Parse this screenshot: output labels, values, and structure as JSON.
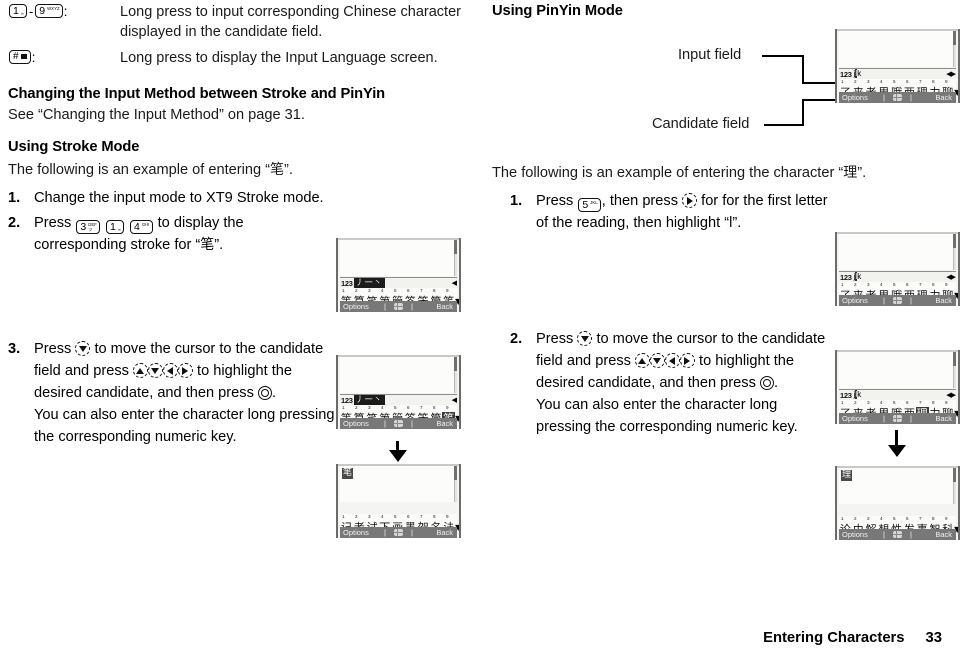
{
  "left_column": {
    "key_rows": [
      {
        "key_from": {
          "number": "1",
          "sub1": "",
          "sub2": "∞"
        },
        "key_to": {
          "number": "9",
          "sub1": "WXYZ",
          "sub2": ""
        },
        "separator": "-",
        "colon": ":",
        "text": "Long press to input corresponding Chinese character displayed in the candidate field."
      },
      {
        "key_hash": {
          "number": "#",
          "glyph": "block"
        },
        "colon": ":",
        "text": "Long press to display the Input Language screen."
      }
    ],
    "heading_1": "Changing the Input Method between Stroke and PinYin",
    "see_line": "See “Changing the Input Method” on page 31.",
    "heading_2": "Using Stroke Mode",
    "intro": {
      "before": "The following is an example of entering “",
      "char": "笔",
      "after": "”."
    },
    "steps": [
      {
        "num": "1.",
        "text": "Change the input mode to XT9 Stroke mode."
      },
      {
        "num": "2.",
        "text_before": "Press",
        "keys": [
          {
            "number": "3",
            "sub1": "DEF",
            "sub2": "ツ"
          },
          {
            "number": "1",
            "sub1": "",
            "sub2": "∞"
          },
          {
            "number": "4",
            "sub1": "GHI",
            "sub2": ""
          }
        ],
        "text_mid": "to display the corresponding stroke for “",
        "char": "笔",
        "text_after": "”."
      },
      {
        "num": "3.",
        "text_a": "Press",
        "icon_a": "nav-down-icon",
        "text_b": "to move the cursor to the candidate field and press",
        "icons_b": [
          "nav-up-icon",
          "nav-down-icon",
          "nav-left-icon",
          "nav-right-icon"
        ],
        "text_c": "to highlight the desired candidate, and then press",
        "icon_c": "center-select-icon",
        "text_d": ".",
        "text_e": "You can also enter the character long pressing the corresponding numeric key."
      }
    ]
  },
  "right_column": {
    "heading": "Using PinYin Mode",
    "callouts": {
      "input_field": "Input field",
      "candidate_field": "Candidate field"
    },
    "intro": {
      "before": "The following is an example of entering the character “",
      "char": "理",
      "after": "”."
    },
    "steps": [
      {
        "num": "1.",
        "text_a": "Press",
        "key": {
          "number": "5",
          "sub1": "JKL",
          "sub2": ""
        },
        "text_b": ", then press",
        "icon": "nav-right-icon",
        "text_c": "for for the first letter of the reading, then highlight “l”."
      },
      {
        "num": "2.",
        "text_a": "Press",
        "icon_a": "nav-down-icon",
        "text_b": "to move the cursor to the candidate field and press",
        "icons_b": [
          "nav-up-icon",
          "nav-down-icon",
          "nav-left-icon",
          "nav-right-icon"
        ],
        "text_c": "to highlight the desired candidate, and then press",
        "icon_c": "center-select-icon",
        "text_d": ".",
        "text_e": "You can also enter the character long pressing the corresponding numeric key."
      }
    ]
  },
  "phone_screens": {
    "stroke_1": {
      "mode_badge": "123",
      "reading": "丿一丶",
      "reading_style": "stroke",
      "number_strip": [
        "1",
        "2",
        "3",
        "4",
        "5",
        "6",
        "7",
        "8",
        "9"
      ],
      "candidates": [
        "等",
        "算",
        "笑",
        "第",
        "管",
        "答",
        "笨",
        "筒",
        "笔"
      ],
      "selected_index": -1,
      "scroll_arrow": "◀",
      "more_arrow": "▼",
      "softkeys": {
        "left": "Options",
        "center": "center-key-icon",
        "right": "Back"
      },
      "input_text": ""
    },
    "stroke_2": {
      "mode_badge": "123",
      "reading": "丿一丶",
      "reading_style": "stroke",
      "number_strip": [
        "1",
        "2",
        "3",
        "4",
        "5",
        "6",
        "7",
        "8",
        "9"
      ],
      "candidates": [
        "等",
        "算",
        "笑",
        "第",
        "管",
        "答",
        "笨",
        "筒",
        "笔"
      ],
      "selected_index": 8,
      "scroll_arrow": "◀",
      "more_arrow": "▼",
      "softkeys": {
        "left": "Options",
        "center": "center-key-icon",
        "right": "Back"
      },
      "input_text": ""
    },
    "stroke_3": {
      "mode_badge": "",
      "reading": "",
      "reading_style": "none",
      "number_strip": [
        "1",
        "2",
        "3",
        "4",
        "5",
        "6",
        "7",
        "8",
        "9"
      ],
      "candidates": [
        "记",
        "者",
        "试",
        "下",
        "画",
        "墨",
        "架",
        "名",
        "法"
      ],
      "selected_index": -1,
      "more_arrow": "▼",
      "softkeys": {
        "left": "Options",
        "center": "center-key-icon",
        "right": "Back"
      },
      "input_text": "笔"
    },
    "pinyin_1": {
      "mode_badge": "123",
      "reading": "jlk",
      "reading_style": "pinyin",
      "reading_cursor_index": 1,
      "number_strip": [
        "1",
        "2",
        "3",
        "4",
        "5",
        "6",
        "7",
        "8",
        "9"
      ],
      "candidates": [
        "了",
        "来",
        "老",
        "里",
        "哦",
        "两",
        "理",
        "力",
        "聊"
      ],
      "selected_index": -1,
      "scroll_arrow": "◀▶",
      "more_arrow": "▼",
      "softkeys": {
        "left": "Options",
        "center": "center-key-icon",
        "right": "Back"
      },
      "input_text": ""
    },
    "pinyin_2": {
      "mode_badge": "123",
      "reading": "jlk",
      "reading_style": "pinyin",
      "reading_cursor_index": 1,
      "number_strip": [
        "1",
        "2",
        "3",
        "4",
        "5",
        "6",
        "7",
        "8",
        "9"
      ],
      "candidates": [
        "了",
        "来",
        "老",
        "里",
        "哦",
        "两",
        "理",
        "力",
        "聊"
      ],
      "selected_index": -1,
      "scroll_arrow": "◀▶",
      "more_arrow": "▼",
      "softkeys": {
        "left": "Options",
        "center": "center-key-icon",
        "right": "Back"
      },
      "input_text": ""
    },
    "pinyin_3": {
      "mode_badge": "123",
      "reading": "jlk",
      "reading_style": "pinyin",
      "reading_cursor_index": 1,
      "number_strip": [
        "1",
        "2",
        "3",
        "4",
        "5",
        "6",
        "7",
        "8",
        "9"
      ],
      "candidates": [
        "了",
        "来",
        "老",
        "里",
        "哦",
        "两",
        "理",
        "力",
        "聊"
      ],
      "selected_index": 6,
      "scroll_arrow": "◀▶",
      "more_arrow": "▼",
      "softkeys": {
        "left": "Options",
        "center": "center-key-icon",
        "right": "Back"
      },
      "input_text": ""
    },
    "pinyin_4": {
      "mode_badge": "",
      "reading": "",
      "reading_style": "none",
      "number_strip": [
        "1",
        "2",
        "3",
        "4",
        "5",
        "6",
        "7",
        "8",
        "9"
      ],
      "candidates": [
        "论",
        "由",
        "解",
        "想",
        "性",
        "发",
        "事",
        "智",
        "科"
      ],
      "selected_index": -1,
      "more_arrow": "▼",
      "softkeys": {
        "left": "Options",
        "center": "center-key-icon",
        "right": "Back"
      },
      "input_text": "理"
    }
  },
  "footer": {
    "title": "Entering Characters",
    "page": "33"
  }
}
